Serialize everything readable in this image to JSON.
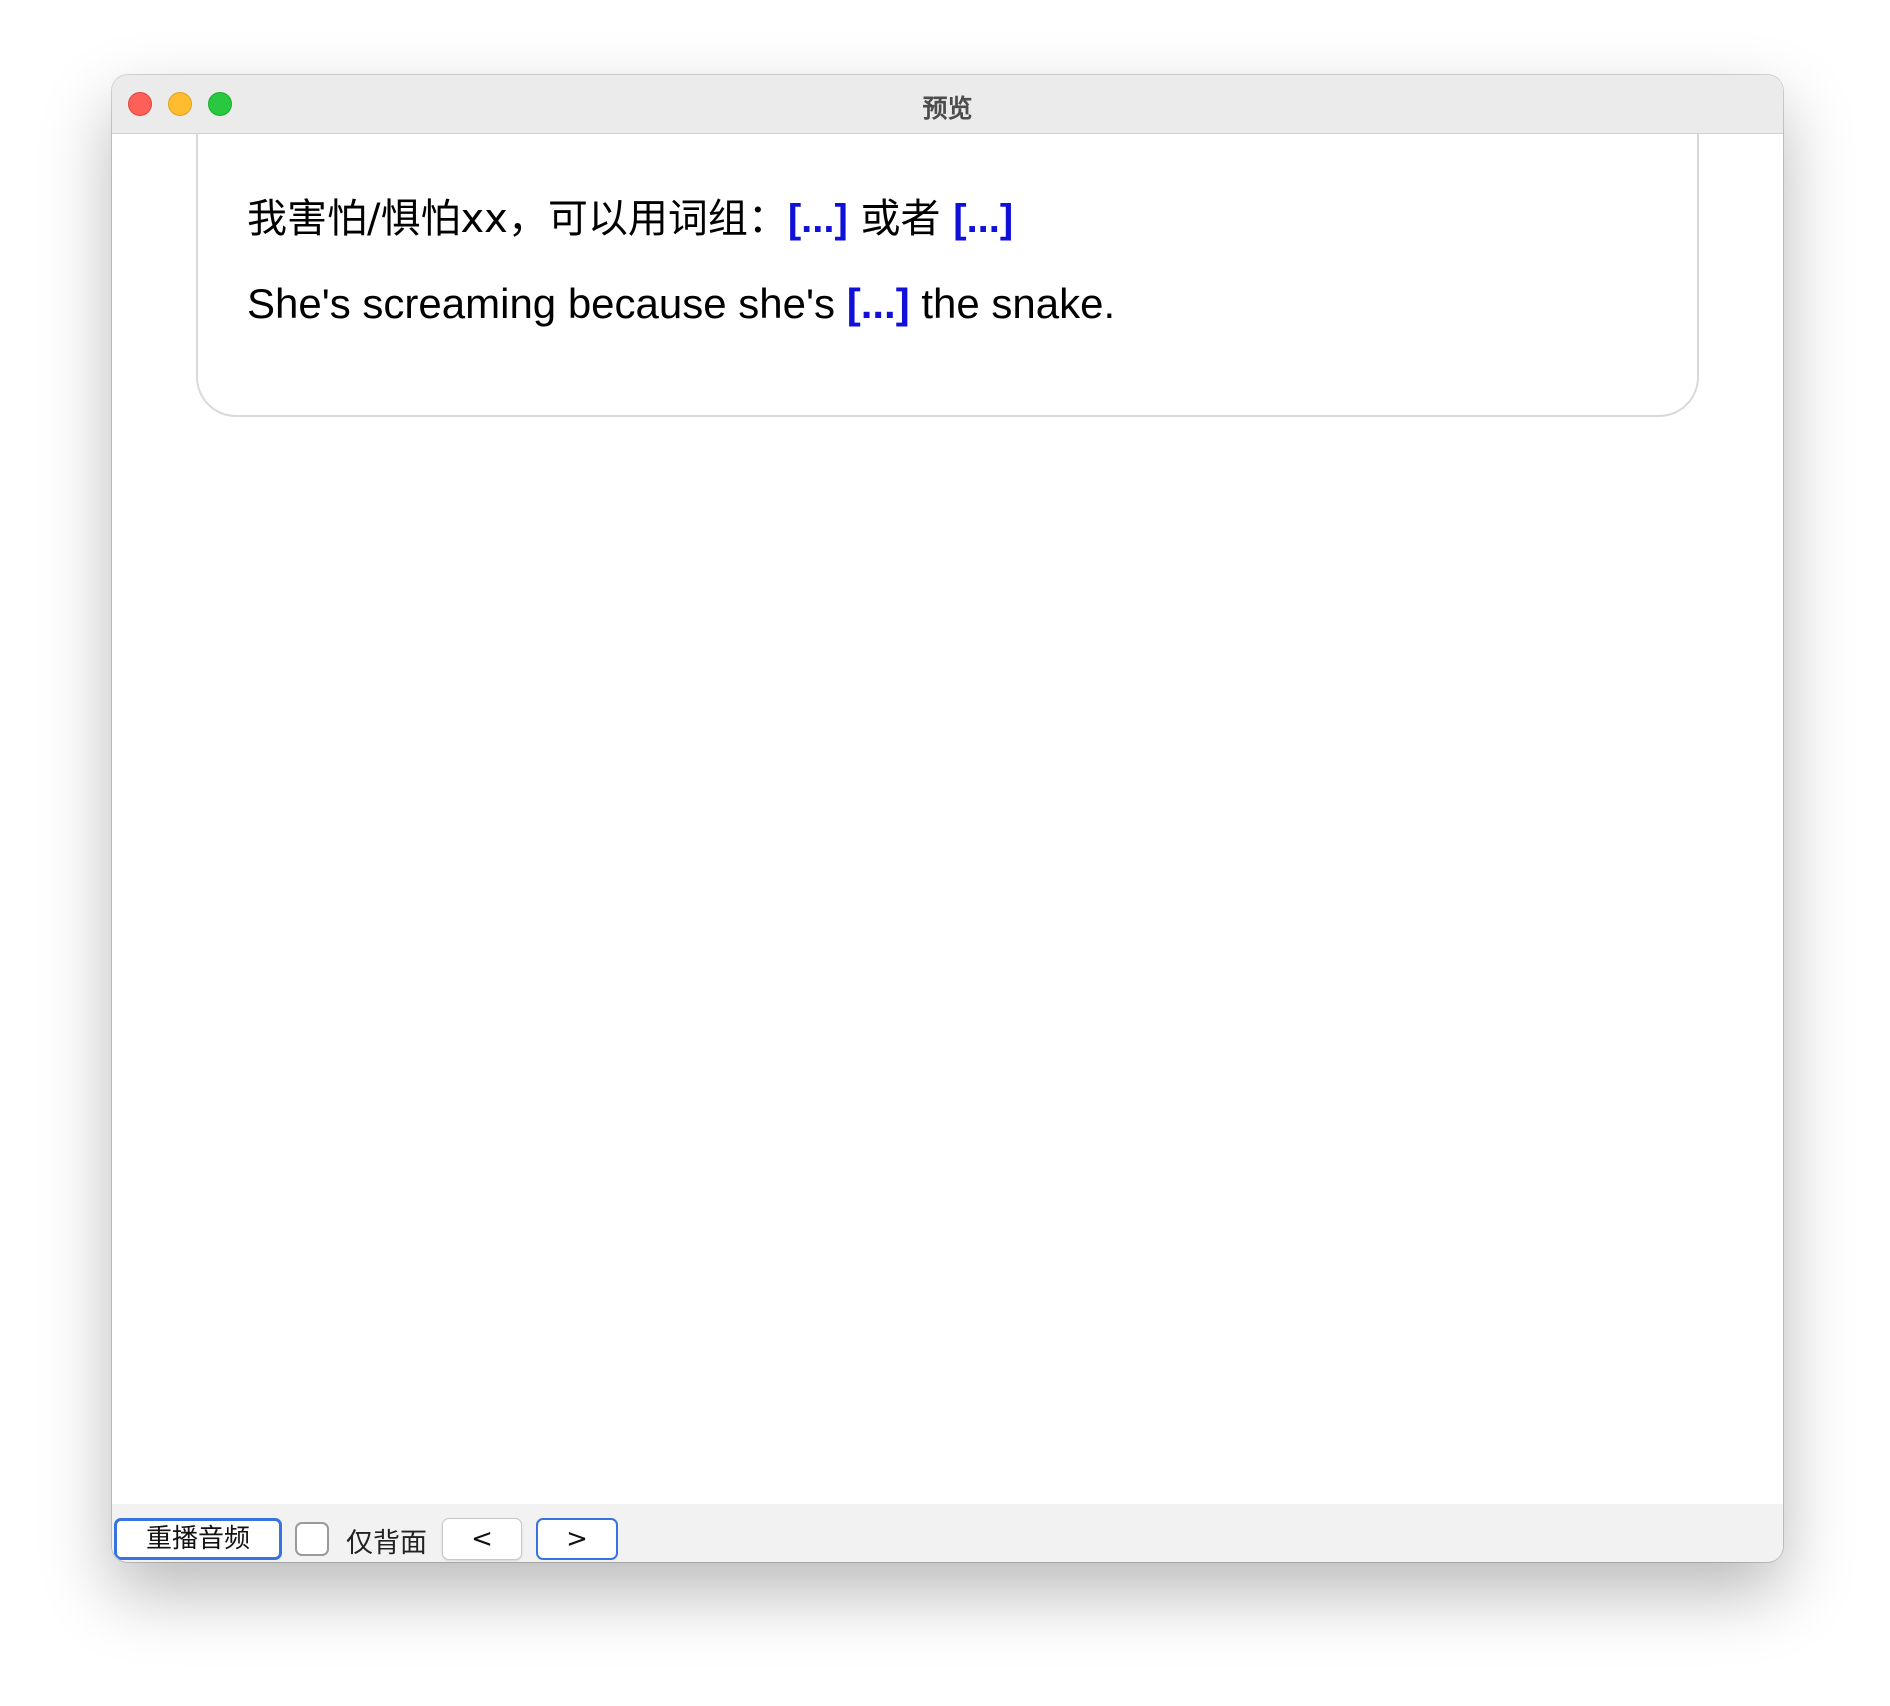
{
  "window": {
    "title": "预览"
  },
  "card": {
    "front": {
      "prefix": "我害怕/惧怕xx，可以用词组：",
      "cloze_1": "[...]",
      "middle": " 或者 ",
      "cloze_2": "[...]"
    },
    "sentence": {
      "before": "She's screaming because she's ",
      "cloze": "[...]",
      "after": " the snake."
    },
    "cloze_color": "#1010d8"
  },
  "toolbar": {
    "replay_label": "重播音频",
    "back_only_checked": false,
    "back_only_label": "仅背面",
    "prev_label": "<",
    "next_label": ">"
  },
  "colors": {
    "accent": "#3874e0",
    "close": "#fe5f57",
    "minimize": "#febc2e",
    "maximize": "#28c840"
  }
}
